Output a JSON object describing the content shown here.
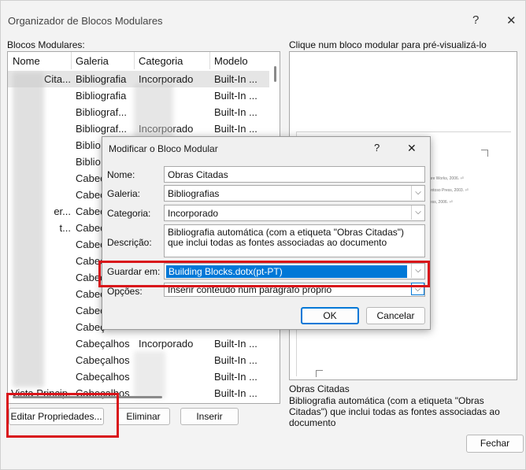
{
  "window": {
    "title": "Organizador de Blocos Modulares",
    "help": "?",
    "close": "✕"
  },
  "list": {
    "label": "Blocos Modulares:",
    "columns": [
      "Nome",
      "Galeria",
      "Categoria",
      "Modelo"
    ],
    "rows": [
      {
        "name": "Cita...",
        "gallery": "Bibliografia",
        "category": "Incorporado",
        "template": "Built-In ..."
      },
      {
        "name": "",
        "gallery": "Bibliografia",
        "category": "",
        "template": "Built-In ..."
      },
      {
        "name": "",
        "gallery": "Bibliograf...",
        "category": "",
        "template": "Built-In ..."
      },
      {
        "name": "",
        "gallery": "Bibliograf...",
        "category": "Incorporado",
        "template": "Built-In ..."
      },
      {
        "name": "",
        "gallery": "Biblio",
        "category": "",
        "template": ""
      },
      {
        "name": "",
        "gallery": "Biblio",
        "category": "",
        "template": ""
      },
      {
        "name": "",
        "gallery": "Cabeç",
        "category": "",
        "template": ""
      },
      {
        "name": "",
        "gallery": "Cabeç",
        "category": "",
        "template": ""
      },
      {
        "name": "er...",
        "gallery": "Cabeç",
        "category": "",
        "template": ""
      },
      {
        "name": "t...",
        "gallery": "Cabeç",
        "category": "",
        "template": ""
      },
      {
        "name": "",
        "gallery": "Cabeç",
        "category": "",
        "template": ""
      },
      {
        "name": "",
        "gallery": "Cabeç",
        "category": "",
        "template": ""
      },
      {
        "name": "",
        "gallery": "Cabeç",
        "category": "",
        "template": ""
      },
      {
        "name": "",
        "gallery": "Cabeç",
        "category": "",
        "template": ""
      },
      {
        "name": "",
        "gallery": "Cabeç",
        "category": "",
        "template": ""
      },
      {
        "name": "",
        "gallery": "Cabeç",
        "category": "",
        "template": ""
      },
      {
        "name": "",
        "gallery": "Cabeçalhos",
        "category": "Incorporado",
        "template": "Built-In ..."
      },
      {
        "name": "",
        "gallery": "Cabeçalhos",
        "category": "",
        "template": "Built-In ..."
      },
      {
        "name": "",
        "gallery": "Cabeçalhos",
        "category": "",
        "template": "Built-In ..."
      },
      {
        "name": "Vista Princip...",
        "gallery": "Cabeçalhos",
        "category": "",
        "template": "Built-In ..."
      }
    ]
  },
  "buttons": {
    "edit": "Editar Propriedades...",
    "delete": "Eliminar",
    "insert": "Inserir",
    "close": "Fechar"
  },
  "preview": {
    "label": "Clique num bloco modular para pré-visualizá-lo",
    "item_title": "Obras Citadas",
    "item_desc": "Bibliografia automática (com a etiqueta \"Obras Citadas\") que inclui todas as fontes associadas ao documento",
    "page_lines": [
      "nture Works, 2006. ⏎",
      "Contoso Press, 2003. ⏎",
      "Press, 2006. ⏎"
    ]
  },
  "dialog": {
    "title": "Modificar o Bloco Modular",
    "help": "?",
    "close": "✕",
    "labels": {
      "name": "Nome:",
      "gallery": "Galeria:",
      "category": "Categoria:",
      "description": "Descrição:",
      "save_in": "Guardar em:",
      "options": "Opções:"
    },
    "values": {
      "name": "Obras Citadas",
      "gallery": "Bibliografias",
      "category": "Incorporado",
      "description": "Bibliografia automática (com a etiqueta \"Obras Citadas\") que inclui todas as fontes associadas ao documento",
      "save_in": "Building Blocks.dotx(pt-PT)",
      "options": "Inserir conteúdo num parágrafo próprio"
    },
    "ok": "OK",
    "cancel": "Cancelar"
  },
  "colors": {
    "highlight": "#d9141a",
    "selection": "#0078d7"
  }
}
